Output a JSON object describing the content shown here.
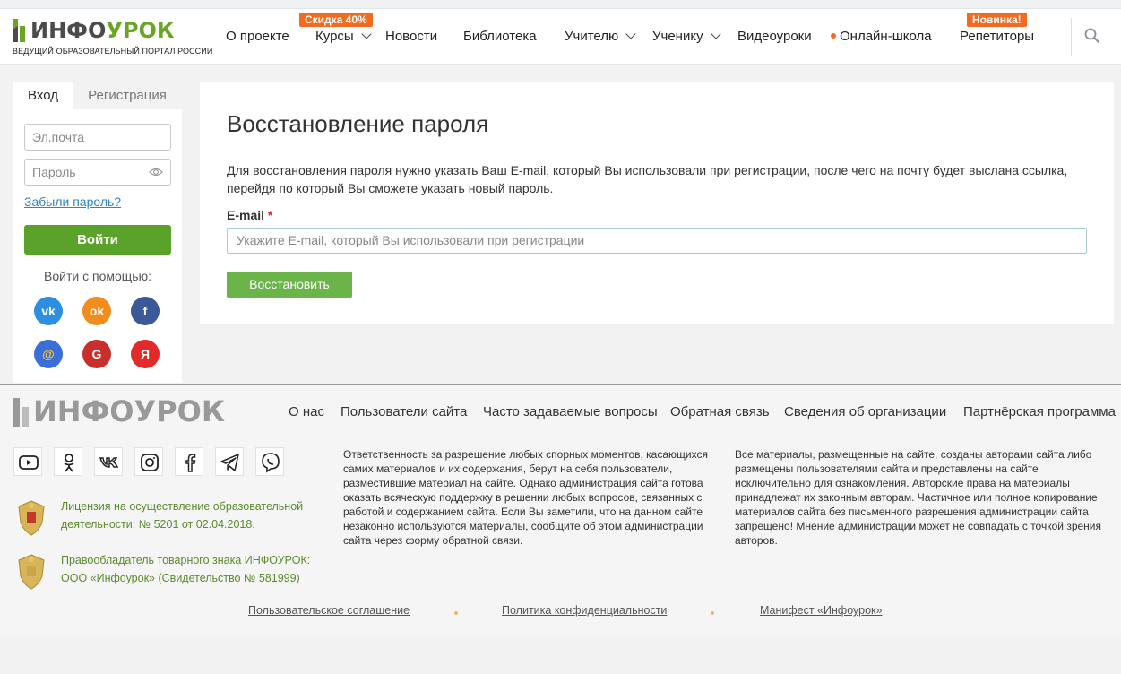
{
  "header": {
    "logo": {
      "name_part1": "ИНФО",
      "name_part2": "УРОК",
      "tagline": "ВЕДУЩИЙ ОБРАЗОВАТЕЛЬНЫЙ ПОРТАЛ РОССИИ"
    },
    "nav": [
      {
        "label": "О проекте"
      },
      {
        "label": "Курсы",
        "badge": "Скидка 40%",
        "dropdown": true
      },
      {
        "label": "Новости"
      },
      {
        "label": "Библиотека"
      },
      {
        "label": "Учителю",
        "dropdown": true
      },
      {
        "label": "Ученику",
        "dropdown": true
      },
      {
        "label": "Видеоуроки"
      },
      {
        "label": "Онлайн-школа",
        "dot": true
      },
      {
        "label": "Репетиторы",
        "badge": "Новинка!"
      }
    ],
    "search_icon": "search-icon"
  },
  "sidebar": {
    "tabs": {
      "login": "Вход",
      "register": "Регистрация"
    },
    "email_placeholder": "Эл.почта",
    "password_placeholder": "Пароль",
    "forgot": "Забыли пароль?",
    "login_button": "Войти",
    "social_label": "Войти с помощью:",
    "social": [
      {
        "name": "vk",
        "glyph": "vk",
        "color": "#2e8fe0"
      },
      {
        "name": "odnoklassniki",
        "glyph": "ok",
        "color": "#f28c1c"
      },
      {
        "name": "facebook",
        "glyph": "f",
        "color": "#3b5998"
      },
      {
        "name": "mail",
        "glyph": "@",
        "color": "#3a6fd8"
      },
      {
        "name": "google",
        "glyph": "G",
        "color": "#c8312b"
      },
      {
        "name": "yandex",
        "glyph": "Я",
        "color": "#e22a2a"
      }
    ]
  },
  "main": {
    "title": "Восстановление пароля",
    "description": "Для восстановления пароля нужно указать Ваш E-mail, который Вы использовали при регистрации, после чего на почту будет выслана ссылка, перейдя по который Вы сможете указать новый пароль.",
    "email_label": "E-mail",
    "required_mark": "*",
    "email_placeholder": "Укажите E-mail, который Вы использовали при регистрации",
    "submit": "Восстановить"
  },
  "footer": {
    "logo_text": "ИНФОУРОК",
    "nav": [
      "О нас",
      "Пользователи сайта",
      "Часто задаваемые вопросы",
      "Обратная связь",
      "Сведения об организации",
      "Партнёрская программа"
    ],
    "social_icons": [
      "youtube-icon",
      "odnoklassniki-icon",
      "vk-icon",
      "instagram-icon",
      "facebook-icon",
      "telegram-icon",
      "viber-icon"
    ],
    "license": "Лицензия на осуществление образовательной деятельности: № 5201 от 02.04.2018.",
    "trademark": "Правообладатель товарного знака ИНФОУРОК: ООО «Инфоурок» (Свидетельство № 581999)",
    "responsibility": "Ответственность за разрешение любых спорных моментов, касающихся самих материалов и их содержания, берут на себя пользователи, разместившие материал на сайте. Однако администрация сайта готова оказать всяческую поддержку в решении любых вопросов, связанных с работой и содержанием сайта. Если Вы заметили, что на данном сайте незаконно используются материалы, сообщите об этом администрации сайта через форму обратной связи.",
    "copyright": "Все материалы, размещенные на сайте, созданы авторами сайта либо размещены пользователями сайта и представлены на сайте исключительно для ознакомления. Авторские права на материалы принадлежат их законным авторам. Частичное или полное копирование материалов сайта без письменного разрешения администрации сайта запрещено! Мнение администрации может не совпадать с точкой зрения авторов.",
    "links": [
      "Пользовательское соглашение",
      "Политика конфиденциальности",
      "Манифест «Инфоурок»"
    ]
  }
}
